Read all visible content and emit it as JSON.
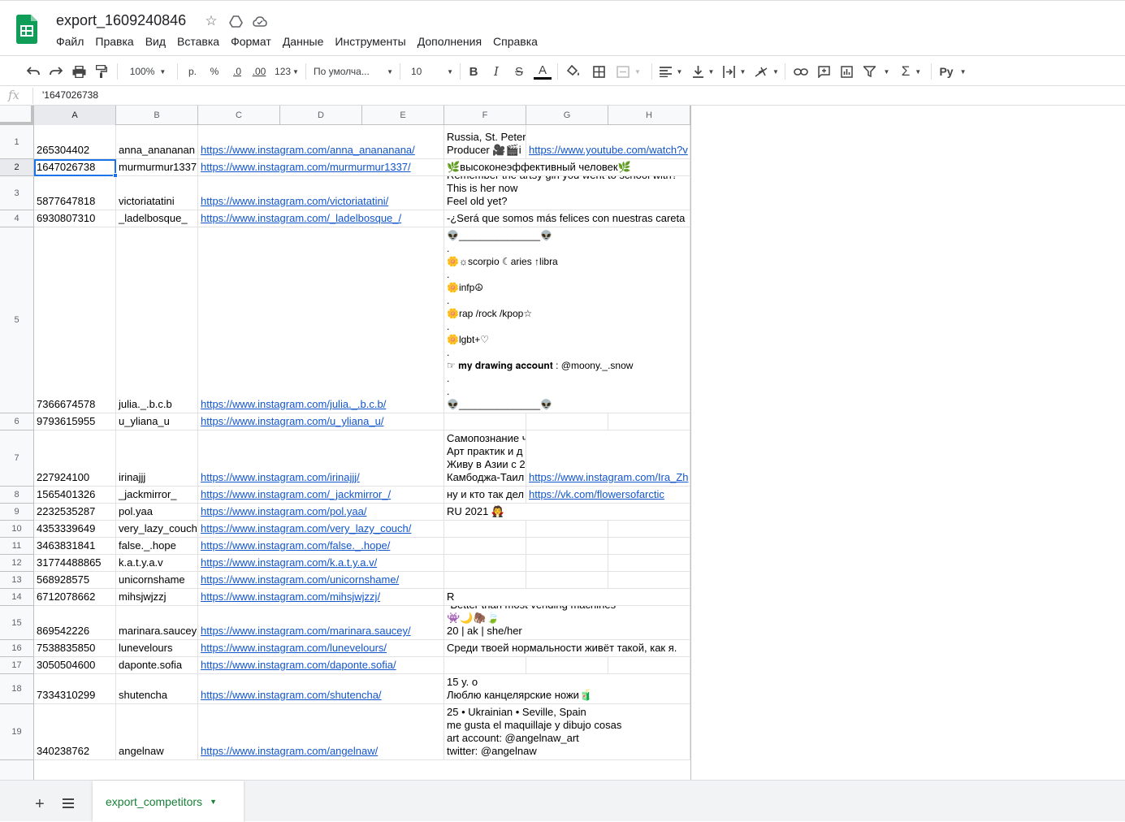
{
  "app": {
    "doc_title": "export_1609240846",
    "menu": [
      "Файл",
      "Правка",
      "Вид",
      "Вставка",
      "Формат",
      "Данные",
      "Инструменты",
      "Дополнения",
      "Справка"
    ],
    "icons": [
      "star-icon",
      "drive-icon",
      "cloud-status-icon"
    ]
  },
  "toolbar": {
    "zoom": "100%",
    "currency": "р.",
    "percent": "%",
    "dec_less": ".0",
    "dec_more": ".00",
    "more_formats": "123",
    "font": "По умолча...",
    "font_size": "10",
    "bold": "B",
    "italic": "I",
    "strike": "S",
    "text_color": "A",
    "input_tools": "Ру"
  },
  "formula_bar": {
    "fx": "fx",
    "value": "'1647026738"
  },
  "columns": [
    "A",
    "B",
    "C",
    "D",
    "E",
    "F",
    "G",
    "H"
  ],
  "rows": [
    {
      "n": "1",
      "a": "265304402",
      "b": "anna_anananan",
      "c": "https://www.instagram.com/anna_anananana/",
      "f": [
        "Russia, St. Peter",
        "Producer 🎥🎬i"
      ],
      "g": "https://www.youtube.com/watch?v"
    },
    {
      "n": "2",
      "a": "1647026738",
      "b": "murmurmur1337",
      "c": "https://www.instagram.com/murmurmur1337/",
      "f": [
        "🌿высоконеэффективный человек🌿"
      ],
      "g": ""
    },
    {
      "n": "3",
      "a": "5877647818",
      "b": "victoriatatini",
      "c": "https://www.instagram.com/victoriatatini/",
      "f": [
        "Remember the artsy girl you went to school with?",
        "This is her now",
        "Feel old yet?"
      ],
      "g": ""
    },
    {
      "n": "4",
      "a": "6930807310",
      "b": "_ladelbosque_",
      "c": "https://www.instagram.com/_ladelbosque_/",
      "f": [
        "-¿Será que somos más felices con nuestras careta"
      ],
      "g": ""
    },
    {
      "n": "5",
      "a": "7366674578",
      "b": "julia._.b.c.b",
      "c": "https://www.instagram.com/julia._.b.c.b/",
      "f": [
        "👽_______________👽",
        ".",
        "🌼☼scorpio ☾aries ↑libra",
        ".",
        "🌼infp☮",
        ".",
        "🌼rap /rock /kpop☆",
        ".",
        "🌼lgbt+♡",
        ".",
        "☞ 𝐦𝐲 𝐝𝐫𝐚𝐰𝐢𝐧𝐠 𝐚𝐜𝐜𝐨𝐮𝐧𝐭 : @moony._.snow",
        ".",
        ".",
        "👽_______________👽"
      ],
      "g": ""
    },
    {
      "n": "6",
      "a": "9793615955",
      "b": "u_yliana_u",
      "c": "https://www.instagram.com/u_yliana_u/",
      "f": [
        ""
      ],
      "g": ""
    },
    {
      "n": "7",
      "a": "227924100",
      "b": "irinajjj",
      "c": "https://www.instagram.com/irinajjj/",
      "f": [
        "Самопознание ч",
        "Арт практик и д",
        "Живу в Азии с 2",
        "Камбоджа-Таил"
      ],
      "g": "https://www.instagram.com/Ira_Zh"
    },
    {
      "n": "8",
      "a": "1565401326",
      "b": "_jackmirror_",
      "c": "https://www.instagram.com/_jackmirror_/",
      "f": [
        "ну и кто так дел"
      ],
      "g": "https://vk.com/flowersofarctic"
    },
    {
      "n": "9",
      "a": "2232535287",
      "b": "pol.yaa",
      "c": "https://www.instagram.com/pol.yaa/",
      "f": [
        "RU 2021 🧛"
      ],
      "g": ""
    },
    {
      "n": "10",
      "a": "4353339649",
      "b": "very_lazy_couch",
      "c": "https://www.instagram.com/very_lazy_couch/",
      "f": [
        ""
      ],
      "g": ""
    },
    {
      "n": "11",
      "a": "3463831841",
      "b": "false._.hope",
      "c": "https://www.instagram.com/false._.hope/",
      "f": [
        ""
      ],
      "g": ""
    },
    {
      "n": "12",
      "a": "31774488865",
      "b": "k.a.t.y.a.v",
      "c": "https://www.instagram.com/k.a.t.y.a.v/",
      "f": [
        ""
      ],
      "g": ""
    },
    {
      "n": "13",
      "a": "568928575",
      "b": "unicornshame",
      "c": "https://www.instagram.com/unicornshame/",
      "f": [
        ""
      ],
      "g": ""
    },
    {
      "n": "14",
      "a": "6712078662",
      "b": "mihsjwjzzj",
      "c": "https://www.instagram.com/mihsjwjzzj/",
      "f": [
        "R"
      ],
      "g": ""
    },
    {
      "n": "15",
      "a": "869542226",
      "b": "marinara.saucey",
      "c": "https://www.instagram.com/marinara.saucey/",
      "f": [
        "“Better than most vending machines”",
        "👾🌙🦣🍃",
        "20 | ak | she/her"
      ],
      "g": ""
    },
    {
      "n": "16",
      "a": "7538835850",
      "b": "lunevelours",
      "c": "https://www.instagram.com/lunevelours/",
      "f": [
        "Среди твоей нормальности живёт такой, как я."
      ],
      "g": ""
    },
    {
      "n": "17",
      "a": "3050504600",
      "b": "daponte.sofia",
      "c": "https://www.instagram.com/daponte.sofia/",
      "f": [
        ""
      ],
      "g": ""
    },
    {
      "n": "18",
      "a": "7334310299",
      "b": "shutencha",
      "c": "https://www.instagram.com/shutencha/",
      "f": [
        "15 y. o",
        "Люблю канцелярские ножи🧃"
      ],
      "g": ""
    },
    {
      "n": "19",
      "a": "340238762",
      "b": "angelnaw",
      "c": "https://www.instagram.com/angelnaw/",
      "f": [
        "25 • Ukrainian • Seville, Spain",
        "me gusta el maquillaje y dibujo cosas",
        "art account: @angelnaw_art",
        "twitter: @angelnaw"
      ],
      "g": ""
    }
  ],
  "sheets": {
    "active": "export_competitors"
  }
}
